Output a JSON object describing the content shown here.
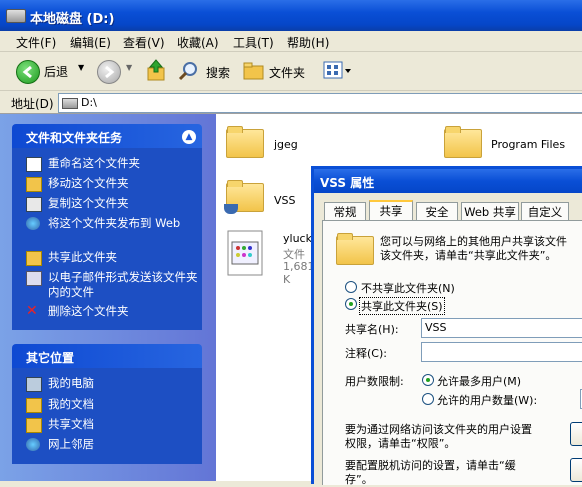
{
  "window": {
    "title": "本地磁盘 (D:)"
  },
  "menu": [
    "文件(F)",
    "编辑(E)",
    "查看(V)",
    "收藏(A)",
    "工具(T)",
    "帮助(H)"
  ],
  "toolbar": {
    "back": "后退",
    "search": "搜索",
    "folders": "文件夹"
  },
  "address": {
    "label": "地址(D)",
    "value": "D:\\"
  },
  "tasks": {
    "header": "文件和文件夹任务",
    "items": [
      "重命名这个文件夹",
      "移动这个文件夹",
      "复制这个文件夹",
      "将这个文件夹发布到 Web",
      "共享此文件夹",
      "以电子邮件形式发送该文件夹内的文件",
      "删除这个文件夹"
    ]
  },
  "places": {
    "header": "其它位置",
    "items": [
      "我的电脑",
      "我的文档",
      "共享文档",
      "网上邻居"
    ]
  },
  "files": {
    "jgeg": "jgeg",
    "program_files": "Program Files",
    "vss": "VSS",
    "yluck_name": "yluck",
    "yluck_type": "文件",
    "yluck_size": "1,681 K"
  },
  "dialog": {
    "title": "VSS 属性",
    "tabs": [
      "常规",
      "共享",
      "安全",
      "Web 共享",
      "自定义"
    ],
    "description": "您可以与网络上的其他用户共享该文件夹。要共享该文件夹，请单击“共享此文件夹”。",
    "desc_line1": "您可以与网络上的其他用户共享该文件",
    "desc_line2": "该文件夹，请单击“共享此文件夹”。",
    "no_share": "不共享此文件夹(N)",
    "share": "共享此文件夹(S)",
    "share_name_label": "共享名(H):",
    "share_name_value": "VSS",
    "comment_label": "注释(C):",
    "user_limit_label": "用户数限制:",
    "max_users": "允许最多用户(M)",
    "allowed_users": "允许的用户数量(W):",
    "perm_line1": "要为通过网络访问该文件夹的用户设置",
    "perm_line2": "权限，请单击“权限”。",
    "cache_line1": "要配置脱机访问的设置，请单击“缓",
    "cache_line2": "存”。"
  }
}
